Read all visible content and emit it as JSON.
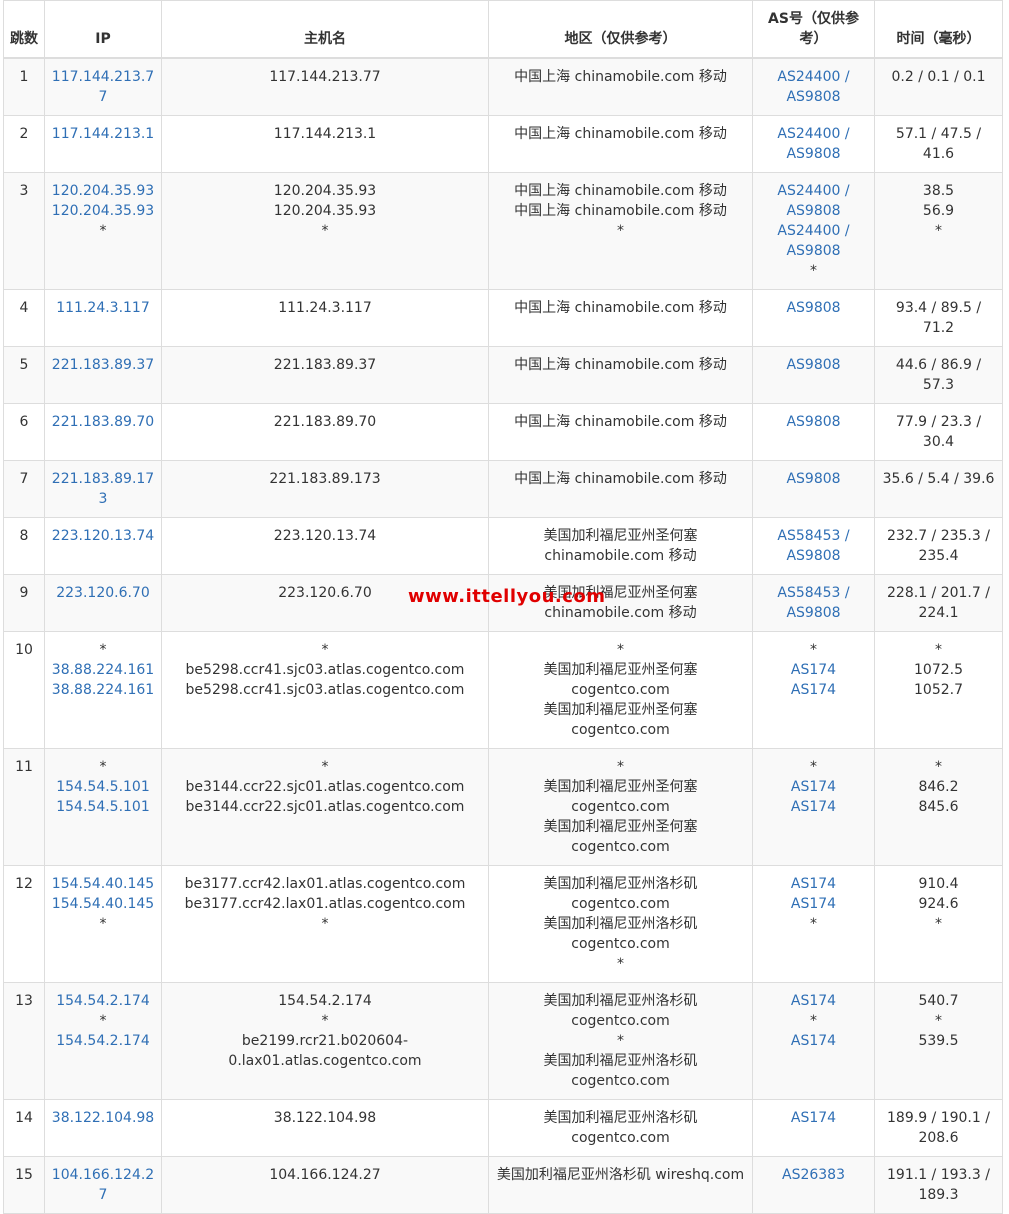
{
  "headers": {
    "hop": "跳数",
    "ip": "IP",
    "host": "主机名",
    "region": "地区（仅供参考）",
    "as": "AS号（仅供参考）",
    "time": "时间（毫秒）"
  },
  "watermark": "www.ittellyou.com",
  "link_color": "#2f6fb5",
  "rows": [
    {
      "hop": "1",
      "ip": [
        "117.144.213.77"
      ],
      "host": [
        "117.144.213.77"
      ],
      "region": [
        "中国上海 chinamobile.com 移动"
      ],
      "as": [
        "AS24400 /",
        "AS9808"
      ],
      "time": [
        "0.2 / 0.1 / 0.1"
      ]
    },
    {
      "hop": "2",
      "ip": [
        "117.144.213.1"
      ],
      "host": [
        "117.144.213.1"
      ],
      "region": [
        "中国上海 chinamobile.com 移动"
      ],
      "as": [
        "AS24400 /",
        "AS9808"
      ],
      "time": [
        "57.1 / 47.5 /",
        "41.6"
      ]
    },
    {
      "hop": "3",
      "ip": [
        "120.204.35.93",
        "120.204.35.93",
        "*"
      ],
      "host": [
        "120.204.35.93",
        "120.204.35.93",
        "*"
      ],
      "region": [
        "中国上海 chinamobile.com 移动",
        "中国上海 chinamobile.com 移动",
        "*"
      ],
      "as": [
        "AS24400 /",
        "AS9808",
        "AS24400 /",
        "AS9808",
        "*"
      ],
      "time": [
        "38.5",
        "56.9",
        "*"
      ]
    },
    {
      "hop": "4",
      "ip": [
        "111.24.3.117"
      ],
      "host": [
        "111.24.3.117"
      ],
      "region": [
        "中国上海 chinamobile.com 移动"
      ],
      "as": [
        "AS9808"
      ],
      "time": [
        "93.4 / 89.5 /",
        "71.2"
      ]
    },
    {
      "hop": "5",
      "ip": [
        "221.183.89.37"
      ],
      "host": [
        "221.183.89.37"
      ],
      "region": [
        "中国上海 chinamobile.com 移动"
      ],
      "as": [
        "AS9808"
      ],
      "time": [
        "44.6 / 86.9 /",
        "57.3"
      ]
    },
    {
      "hop": "6",
      "ip": [
        "221.183.89.70"
      ],
      "host": [
        "221.183.89.70"
      ],
      "region": [
        "中国上海 chinamobile.com 移动"
      ],
      "as": [
        "AS9808"
      ],
      "time": [
        "77.9 / 23.3 /",
        "30.4"
      ]
    },
    {
      "hop": "7",
      "ip": [
        "221.183.89.173"
      ],
      "host": [
        "221.183.89.173"
      ],
      "region": [
        "中国上海 chinamobile.com 移动"
      ],
      "as": [
        "AS9808"
      ],
      "time": [
        "35.6 / 5.4 / 39.6"
      ]
    },
    {
      "hop": "8",
      "ip": [
        "223.120.13.74"
      ],
      "host": [
        "223.120.13.74"
      ],
      "region": [
        "美国加利福尼亚州圣何塞",
        "chinamobile.com 移动"
      ],
      "as": [
        "AS58453 /",
        "AS9808"
      ],
      "time": [
        "232.7 / 235.3 /",
        "235.4"
      ]
    },
    {
      "hop": "9",
      "ip": [
        "223.120.6.70"
      ],
      "host": [
        "223.120.6.70"
      ],
      "region": [
        "美国加利福尼亚州圣何塞",
        "chinamobile.com 移动"
      ],
      "as": [
        "AS58453 /",
        "AS9808"
      ],
      "time": [
        "228.1 / 201.7 /",
        "224.1"
      ]
    },
    {
      "hop": "10",
      "ip": [
        "*",
        "38.88.224.161",
        "38.88.224.161"
      ],
      "host": [
        "*",
        "be5298.ccr41.sjc03.atlas.cogentco.com",
        "be5298.ccr41.sjc03.atlas.cogentco.com"
      ],
      "region": [
        "*",
        "美国加利福尼亚州圣何塞",
        "cogentco.com",
        "美国加利福尼亚州圣何塞",
        "cogentco.com"
      ],
      "as": [
        "*",
        "AS174",
        "AS174"
      ],
      "time": [
        "*",
        "1072.5",
        "1052.7"
      ]
    },
    {
      "hop": "11",
      "ip": [
        "*",
        "154.54.5.101",
        "154.54.5.101"
      ],
      "host": [
        "*",
        "be3144.ccr22.sjc01.atlas.cogentco.com",
        "be3144.ccr22.sjc01.atlas.cogentco.com"
      ],
      "region": [
        "*",
        "美国加利福尼亚州圣何塞",
        "cogentco.com",
        "美国加利福尼亚州圣何塞",
        "cogentco.com"
      ],
      "as": [
        "*",
        "AS174",
        "AS174"
      ],
      "time": [
        "*",
        "846.2",
        "845.6"
      ]
    },
    {
      "hop": "12",
      "ip": [
        "154.54.40.145",
        "154.54.40.145",
        "*"
      ],
      "host": [
        "be3177.ccr42.lax01.atlas.cogentco.com",
        "be3177.ccr42.lax01.atlas.cogentco.com",
        "*"
      ],
      "region": [
        "美国加利福尼亚州洛杉矶",
        "cogentco.com",
        "美国加利福尼亚州洛杉矶",
        "cogentco.com",
        "*"
      ],
      "as": [
        "AS174",
        "AS174",
        "*"
      ],
      "time": [
        "910.4",
        "924.6",
        "*"
      ]
    },
    {
      "hop": "13",
      "ip": [
        "154.54.2.174",
        "*",
        "154.54.2.174"
      ],
      "host": [
        "154.54.2.174",
        "*",
        "be2199.rcr21.b020604-",
        "0.lax01.atlas.cogentco.com"
      ],
      "region": [
        "美国加利福尼亚州洛杉矶",
        "cogentco.com",
        "*",
        "美国加利福尼亚州洛杉矶",
        "cogentco.com"
      ],
      "as": [
        "AS174",
        "*",
        "AS174"
      ],
      "time": [
        "540.7",
        "*",
        "539.5"
      ]
    },
    {
      "hop": "14",
      "ip": [
        "38.122.104.98"
      ],
      "host": [
        "38.122.104.98"
      ],
      "region": [
        "美国加利福尼亚州洛杉矶",
        "cogentco.com"
      ],
      "as": [
        "AS174"
      ],
      "time": [
        "189.9 / 190.1 /",
        "208.6"
      ]
    },
    {
      "hop": "15",
      "ip": [
        "104.166.124.27"
      ],
      "host": [
        "104.166.124.27"
      ],
      "region": [
        "美国加利福尼亚州洛杉矶 wireshq.com"
      ],
      "as": [
        "AS26383"
      ],
      "time": [
        "191.1 / 193.3 /",
        "189.3"
      ]
    }
  ]
}
